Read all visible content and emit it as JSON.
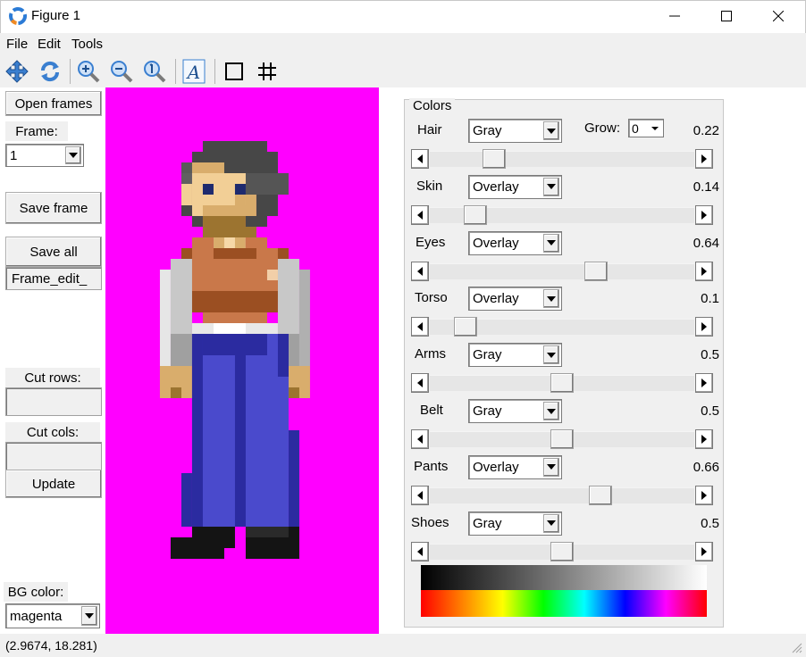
{
  "window": {
    "title": "Figure 1"
  },
  "menu": [
    "File",
    "Edit",
    "Tools"
  ],
  "toolbar": {
    "icons": [
      "pan-icon",
      "reset-icon",
      "zoom-in-icon",
      "zoom-out-icon",
      "zoom-actual-icon",
      "font-icon",
      "square-icon",
      "grid-icon"
    ]
  },
  "left_panel": {
    "open_frames": "Open frames",
    "frame_label": "Frame:",
    "frame_value": "1",
    "save_frame": "Save frame",
    "save_all": "Save all",
    "filename": "Frame_edit_",
    "cut_rows_label": "Cut rows:",
    "cut_rows_value": "",
    "cut_cols_label": "Cut cols:",
    "cut_cols_value": "",
    "update": "Update",
    "bg_color_label": "BG color:",
    "bg_color_value": "magenta"
  },
  "colors": {
    "title": "Colors",
    "grow_label": "Grow:",
    "grow_value": "0",
    "rows": [
      {
        "label": "Hair",
        "mode": "Gray",
        "value": "0.22",
        "slider": 0.22
      },
      {
        "label": "Skin",
        "mode": "Overlay",
        "value": "0.14",
        "slider": 0.14
      },
      {
        "label": "Eyes",
        "mode": "Overlay",
        "value": "0.64",
        "slider": 0.64
      },
      {
        "label": "Torso",
        "mode": "Overlay",
        "value": "0.1",
        "slider": 0.1
      },
      {
        "label": "Arms",
        "mode": "Gray",
        "value": "0.5",
        "slider": 0.5
      },
      {
        "label": "Belt",
        "mode": "Gray",
        "value": "0.5",
        "slider": 0.5
      },
      {
        "label": "Pants",
        "mode": "Overlay",
        "value": "0.66",
        "slider": 0.66
      },
      {
        "label": "Shoes",
        "mode": "Gray",
        "value": "0.5",
        "slider": 0.5
      }
    ]
  },
  "status": {
    "coords": "(2.9674, 18.281)"
  },
  "colors_palette": {
    "canvas_bg": "#ff00ff",
    "hair": "#474747",
    "skin_light": "#f2cf96",
    "skin_mid": "#d9ad6c",
    "skin_dark": "#9c7430",
    "eyes": "#1e2a6e",
    "torso": "#c9784a",
    "torso_dark": "#9b4f22",
    "arms": "#c8c8c8",
    "pants": "#4a4acc",
    "pants_dark": "#2b2ba0",
    "shoes": "#141414"
  }
}
